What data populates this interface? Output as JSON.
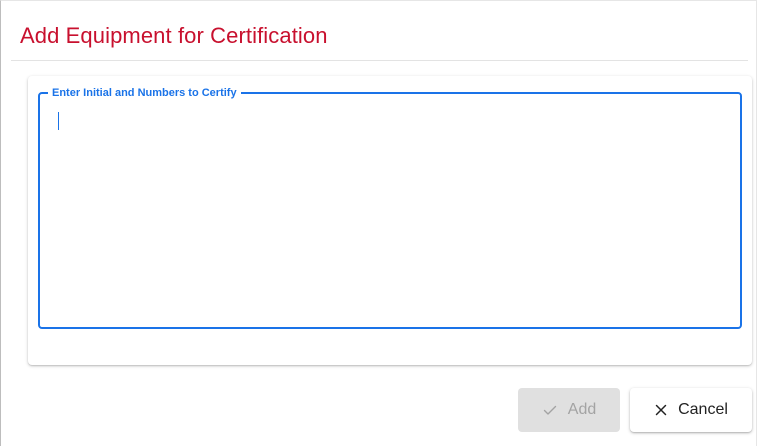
{
  "dialog": {
    "title": "Add Equipment for Certification"
  },
  "input": {
    "label": "Enter Initial and Numbers to Certify",
    "value": ""
  },
  "actions": {
    "add_label": "Add",
    "add_icon": "check-icon",
    "cancel_label": "Cancel",
    "cancel_icon": "close-icon"
  },
  "colors": {
    "title": "#c8102e",
    "accent": "#1a73e8",
    "disabled_bg": "#e0e0e0",
    "disabled_text": "#a3a3a3"
  }
}
